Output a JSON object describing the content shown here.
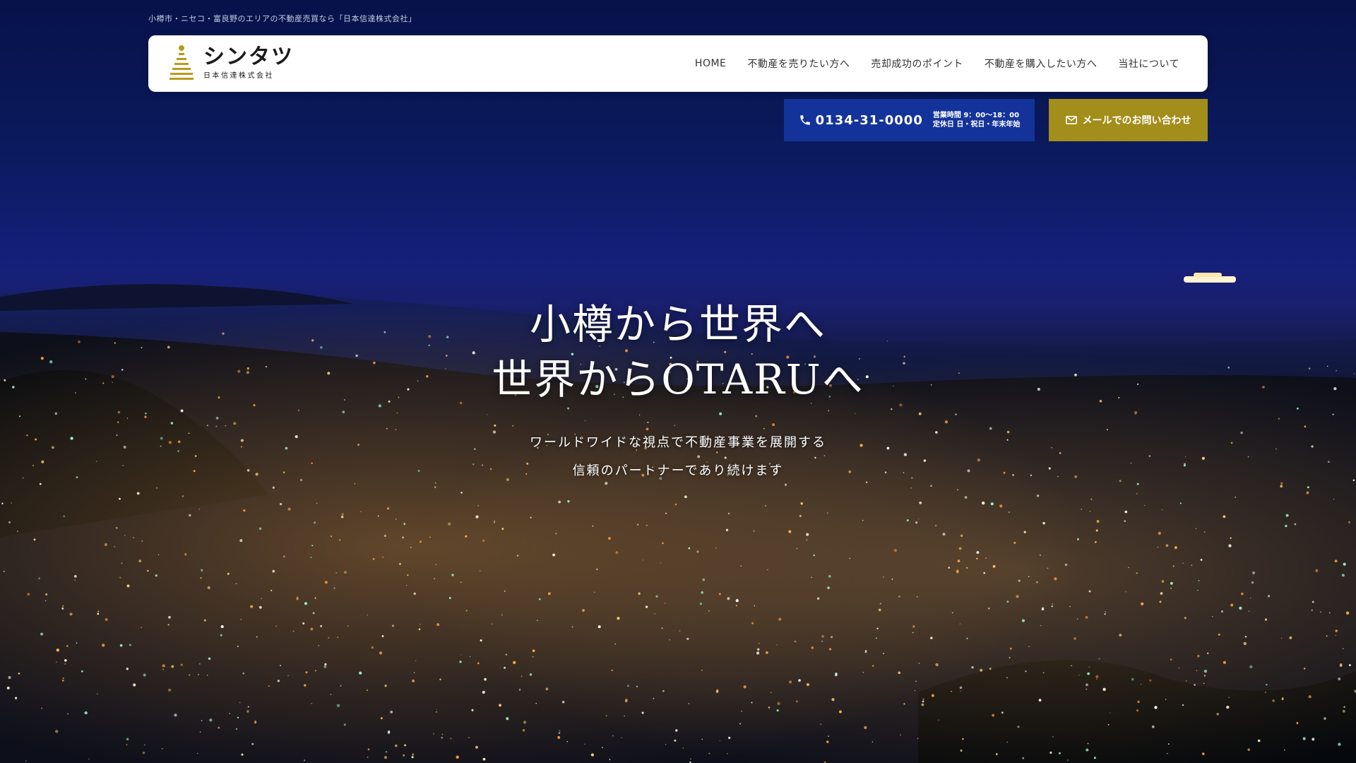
{
  "top_tagline": "小樽市・ニセコ・富良野のエリアの不動産売買なら「日本信達株式会社」",
  "logo": {
    "name": "シンタツ",
    "subtitle": "日本信達株式会社"
  },
  "nav": {
    "items": [
      {
        "label": "HOME"
      },
      {
        "label": "不動産を売りたい方へ"
      },
      {
        "label": "売却成功のポイント"
      },
      {
        "label": "不動産を購入したい方へ"
      },
      {
        "label": "当社について"
      }
    ]
  },
  "contact": {
    "phone": "0134-31-0000",
    "hours_line1": "営業時間 9：00〜18：00",
    "hours_line2": "定休日 日・祝日・年末年始",
    "mail_label": "メールでのお問い合わせ"
  },
  "hero": {
    "headline_line1": "小樽から世界へ",
    "headline_line2": "世界からOTARUへ",
    "sub_line1": "ワールドワイドな視点で不動産事業を展開する",
    "sub_line2": "信頼のパートナーであり続けます"
  },
  "colors": {
    "phone_bg": "#14339a",
    "mail_bg": "#a38d1b",
    "logo_gold": "#b89b1e",
    "header_bg": "#ffffff"
  }
}
